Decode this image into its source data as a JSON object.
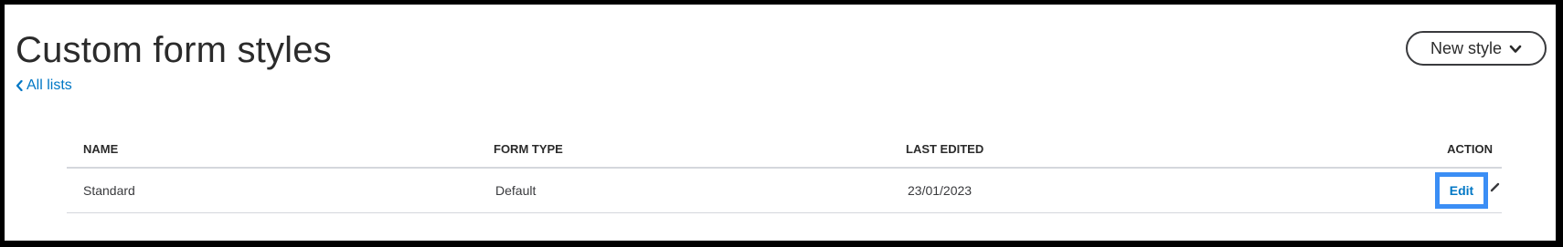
{
  "header": {
    "title": "Custom form styles",
    "back_link": "All lists",
    "new_style_button": "New style"
  },
  "table": {
    "columns": {
      "name": "NAME",
      "form_type": "FORM TYPE",
      "last_edited": "LAST EDITED",
      "action": "ACTION"
    },
    "rows": [
      {
        "name": "Standard",
        "form_type": "Default",
        "last_edited": "23/01/2023",
        "action_label": "Edit"
      }
    ]
  },
  "colors": {
    "link": "#0077c5",
    "focus_ring": "#3b8ef5",
    "text": "#393a3d"
  },
  "icons": {
    "back": "chevron-left-icon",
    "dropdown": "chevron-down-icon",
    "action_menu": "pencil-icon"
  }
}
